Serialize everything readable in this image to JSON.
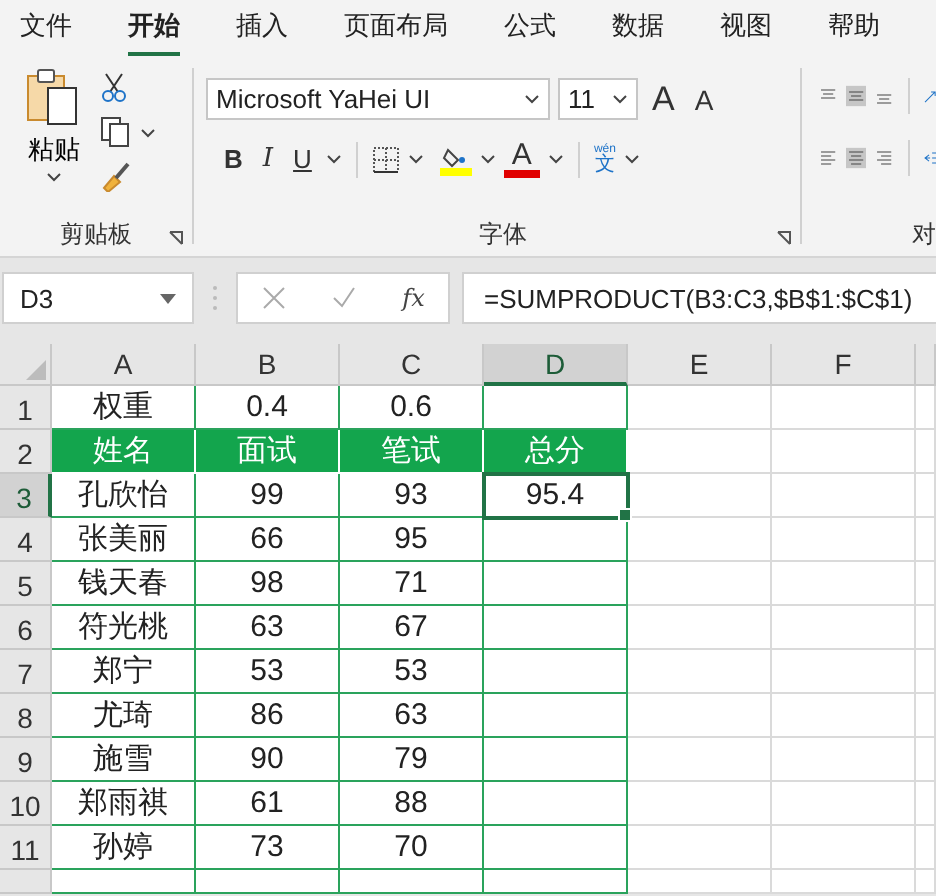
{
  "tabs": [
    {
      "label": "文件",
      "selected": false
    },
    {
      "label": "开始",
      "selected": true
    },
    {
      "label": "插入",
      "selected": false
    },
    {
      "label": "页面布局",
      "selected": false
    },
    {
      "label": "公式",
      "selected": false
    },
    {
      "label": "数据",
      "selected": false
    },
    {
      "label": "视图",
      "selected": false
    },
    {
      "label": "帮助",
      "selected": false
    }
  ],
  "ribbon": {
    "clipboard": {
      "paste_label": "粘贴",
      "group_label": "剪贴板"
    },
    "font": {
      "font_name": "Microsoft YaHei UI",
      "font_size": "11",
      "grow": "A",
      "shrink": "A",
      "bold": "B",
      "italic": "I",
      "underline": "U",
      "font_color": "A",
      "phonetic_top": "wén",
      "phonetic_char": "文",
      "group_label": "字体"
    },
    "alignment": {
      "group_label": "对"
    }
  },
  "formula_bar": {
    "name_box": "D3",
    "fx": "fx",
    "formula": "=SUMPRODUCT(B3:C3,$B$1:$C$1)"
  },
  "columns": [
    {
      "label": "A",
      "selected": false
    },
    {
      "label": "B",
      "selected": false
    },
    {
      "label": "C",
      "selected": false
    },
    {
      "label": "D",
      "selected": true
    },
    {
      "label": "E",
      "selected": false
    },
    {
      "label": "F",
      "selected": false
    }
  ],
  "rows": [
    {
      "number": "1",
      "kind": "weight",
      "selected": false,
      "cells": [
        "权重",
        "0.4",
        "0.6",
        null
      ]
    },
    {
      "number": "2",
      "kind": "header",
      "selected": false,
      "cells": [
        "姓名",
        "面试",
        "笔试",
        "总分"
      ]
    },
    {
      "number": "3",
      "kind": "data",
      "selected": true,
      "cells": [
        "孔欣怡",
        "99",
        "93",
        "95.4"
      ]
    },
    {
      "number": "4",
      "kind": "data",
      "selected": false,
      "cells": [
        "张美丽",
        "66",
        "95",
        null
      ]
    },
    {
      "number": "5",
      "kind": "data",
      "selected": false,
      "cells": [
        "钱天春",
        "98",
        "71",
        null
      ]
    },
    {
      "number": "6",
      "kind": "data",
      "selected": false,
      "cells": [
        "符光桃",
        "63",
        "67",
        null
      ]
    },
    {
      "number": "7",
      "kind": "data",
      "selected": false,
      "cells": [
        "郑宁",
        "53",
        "53",
        null
      ]
    },
    {
      "number": "8",
      "kind": "data",
      "selected": false,
      "cells": [
        "尤琦",
        "86",
        "63",
        null
      ]
    },
    {
      "number": "9",
      "kind": "data",
      "selected": false,
      "cells": [
        "施雪",
        "90",
        "79",
        null
      ]
    },
    {
      "number": "10",
      "kind": "data",
      "selected": false,
      "cells": [
        "郑雨祺",
        "61",
        "88",
        null
      ]
    },
    {
      "number": "11",
      "kind": "data",
      "selected": false,
      "cells": [
        "孙婷",
        "73",
        "70",
        null
      ]
    }
  ]
}
